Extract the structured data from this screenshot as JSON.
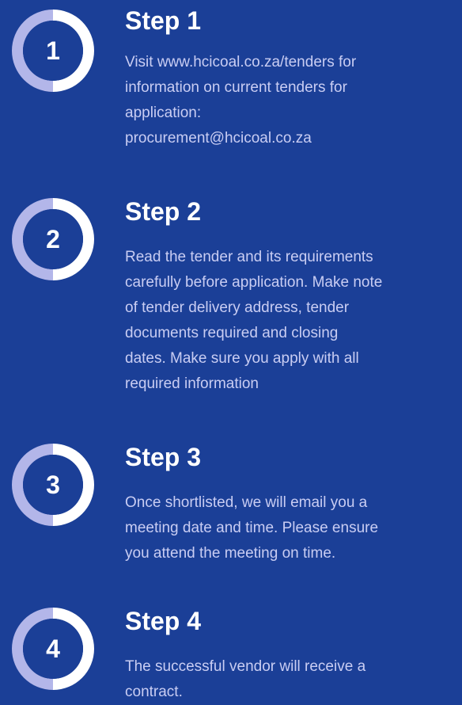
{
  "colors": {
    "background": "#1b3f97",
    "ring_light": "#b3b6e9",
    "ring_dark": "#1b3f97",
    "title": "#ffffff",
    "body_text": "#c9cdf3"
  },
  "steps": [
    {
      "number": "1",
      "title": "Step 1",
      "lines": [
        "Visit www.hcicoal.co.za/tenders for",
        "information on current tenders for",
        "application:",
        "procurement@hcicoal.co.za"
      ]
    },
    {
      "number": "2",
      "title": "Step 2",
      "lines": [
        "Read the tender and its requirements",
        "carefully before application. Make note",
        "of tender delivery address, tender",
        "documents required and closing",
        "dates. Make sure you apply with all",
        "required information"
      ]
    },
    {
      "number": "3",
      "title": "Step 3",
      "lines": [
        "Once shortlisted, we will email you a",
        "meeting date and time. Please ensure",
        "you attend the meeting on time."
      ]
    },
    {
      "number": "4",
      "title": "Step 4",
      "lines": [
        "The successful vendor will receive a",
        "contract."
      ]
    }
  ]
}
